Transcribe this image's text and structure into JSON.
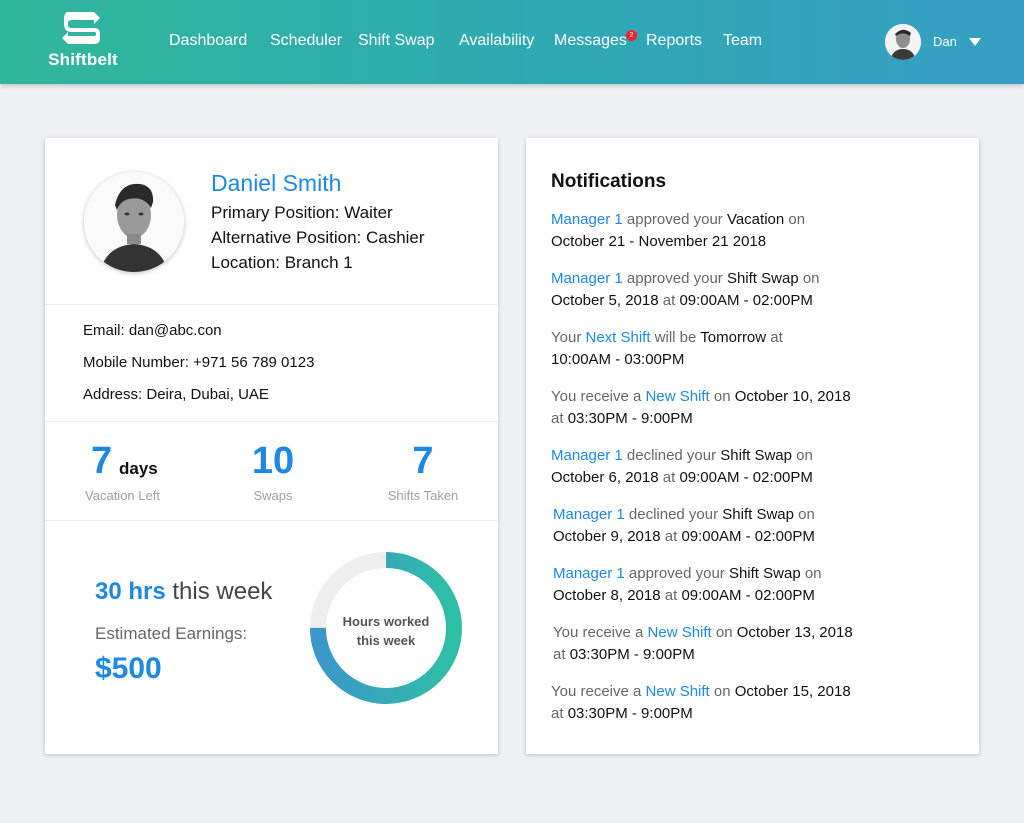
{
  "brand": {
    "name": "Shiftbelt"
  },
  "nav": {
    "dashboard": "Dashboard",
    "scheduler": "Scheduler",
    "shift_swap": "Shift Swap",
    "availability": "Availability",
    "messages": "Messages",
    "messages_badge": "2",
    "reports": "Reports",
    "team": "Team"
  },
  "user": {
    "name": "Dan"
  },
  "profile": {
    "name": "Daniel Smith",
    "primary_position": "Primary Position: Waiter",
    "alternative_position": "Alternative Position: Cashier",
    "location": "Location: Branch 1",
    "email": "Email: dan@abc.con",
    "mobile": "Mobile Number: +971 56 789 0123",
    "address": "Address: Deira, Dubai, UAE"
  },
  "stats": {
    "vacation_value": "7",
    "vacation_unit": "days",
    "vacation_label": "Vacation Left",
    "swaps_value": "10",
    "swaps_label": "Swaps",
    "shifts_value": "7",
    "shifts_label": "Shifts Taken"
  },
  "hours": {
    "value": "30 hrs",
    "suffix": "this week",
    "earnings_label": "Estimated Earnings:",
    "earnings_value": "$500",
    "donut_line1": "Hours worked",
    "donut_line2": "this week",
    "progress_fraction": 0.75
  },
  "notifications": {
    "title": "Notifications",
    "items": [
      {
        "a": "Manager 1",
        "b": " approved your ",
        "c": "Vacation",
        "d": " on",
        "e": "October 21 - November 21 2018",
        "f": "",
        "g": ""
      },
      {
        "a": "Manager 1",
        "b": " approved your ",
        "c": "Shift Swap",
        "d": " on",
        "e": "October 5, 2018",
        "f": " at ",
        "g": "09:00AM - 02:00PM"
      },
      {
        "a0": "Your ",
        "a": "Next Shift",
        "b": " will be ",
        "c": "Tomorrow",
        "d": " at",
        "e": "10:00AM - 03:00PM",
        "f": "",
        "g": ""
      },
      {
        "a0": "You receive a ",
        "a": "New Shift",
        "b": " on ",
        "c": "October 10, 2018",
        "d": "",
        "f0": "at ",
        "e": "03:30PM - 9:00PM"
      },
      {
        "a": "Manager 1",
        "b": " declined your ",
        "c": "Shift Swap",
        "d": " on",
        "e": "October 6, 2018",
        "f": " at ",
        "g": "09:00AM - 02:00PM"
      },
      {
        "a": "Manager 1",
        "b": " declined your ",
        "c": "Shift Swap",
        "d": " on",
        "e": "October 9, 2018",
        "f": " at ",
        "g": "09:00AM - 02:00PM"
      },
      {
        "a": "Manager 1",
        "b": " approved your ",
        "c": "Shift Swap",
        "d": " on",
        "e": "October 8, 2018",
        "f": " at ",
        "g": "09:00AM - 02:00PM"
      },
      {
        "a0": "You receive a ",
        "a": "New Shift",
        "b": " on ",
        "c": "October 13, 2018",
        "d": "",
        "f0": "at ",
        "e": "03:30PM - 9:00PM"
      },
      {
        "a0": "You receive a ",
        "a": "New Shift",
        "b": " on ",
        "c": "October 15, 2018",
        "d": "",
        "f0": "at ",
        "e": "03:30PM - 9:00PM"
      }
    ]
  },
  "colors": {
    "accent": "#1e88e5",
    "header_start": "#2fb79a",
    "header_end": "#379fc4",
    "donut_blue": "#3b97c9",
    "donut_teal": "#2fbfa6",
    "donut_track": "#eeeeee"
  }
}
